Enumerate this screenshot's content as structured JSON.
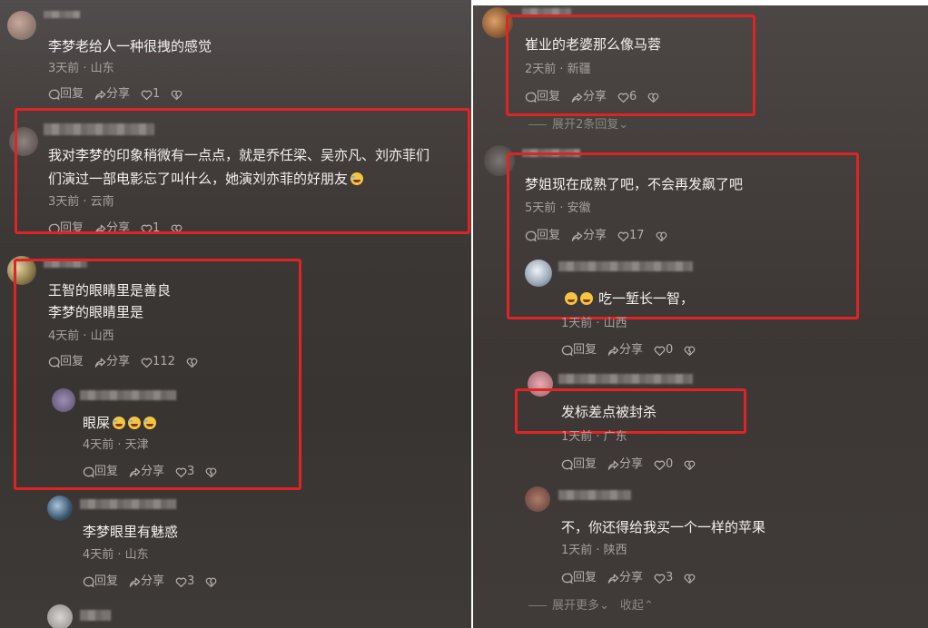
{
  "actions": {
    "reply": "回复",
    "share": "分享"
  },
  "left": {
    "c1": {
      "text": "李梦老给人一种很拽的感觉",
      "meta": "3天前 · 山东",
      "likes": "1"
    },
    "c2": {
      "line1": "我对李梦的印象稍微有一点点，就是乔任梁、吴亦凡、刘亦菲们",
      "line2": "们演过一部电影忘了叫什么，她演刘亦菲的好朋友",
      "meta": "3天前 · 云南",
      "likes": "1"
    },
    "c3": {
      "line1": "王智的眼睛里是善良",
      "line2": "李梦的眼睛里是",
      "meta": "4天前 · 山西",
      "likes": "112"
    },
    "c3r1": {
      "text": "眼屎",
      "meta": "4天前 · 天津",
      "likes": "3"
    },
    "c3r2": {
      "text": "李梦眼里有魅惑",
      "meta": "4天前 · 山东",
      "likes": "3"
    }
  },
  "right": {
    "c1": {
      "text": "崔业的老婆那么像马蓉",
      "meta": "2天前 · 新疆",
      "likes": "6"
    },
    "expand1": "展开2条回复",
    "c2": {
      "text": "梦姐现在成熟了吧，不会再发飙了吧",
      "meta": "5天前 · 安徽",
      "likes": "17"
    },
    "c2r1": {
      "text": "吃一堑长一智，",
      "meta": "1天前 · 山西",
      "likes": "0"
    },
    "c2r2": {
      "text": "发标差点被封杀",
      "meta": "1天前 · 广东",
      "likes": "0"
    },
    "c2r3": {
      "text": "不，你还得给我买一个一样的苹果",
      "meta": "1天前 · 陕西",
      "likes": "3"
    },
    "expand2_more": "展开更多",
    "expand2_collapse": "收起"
  },
  "colors": {
    "highlight": "#e02323",
    "text": "#f3f1ef",
    "meta": "#a7a19d"
  }
}
